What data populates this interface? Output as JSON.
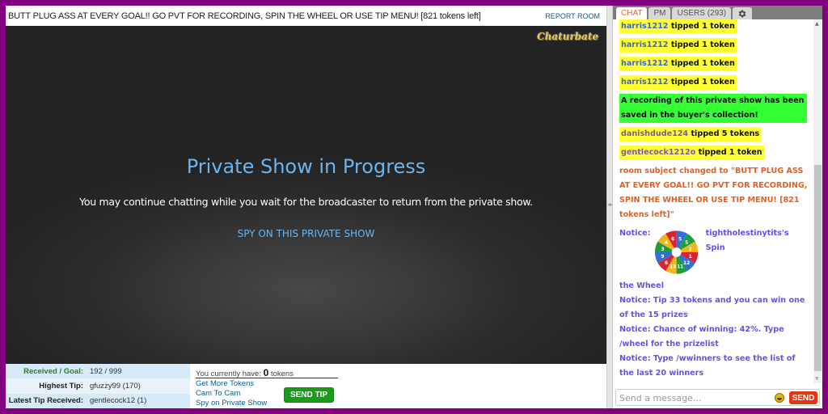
{
  "header": {
    "room_subject": "BUTT PLUG ASS AT EVERY GOAL!! GO PVT FOR RECORDING, SPIN THE WHEEL OR USE TIP MENU! [821 tokens left]",
    "report_room": "REPORT ROOM"
  },
  "video": {
    "logo_text": "Chaturbate",
    "title": "Private Show in Progress",
    "subtitle": "You may continue chatting while you wait for the broadcaster to return from the private show.",
    "spy_link": "SPY ON THIS PRIVATE SHOW"
  },
  "stats": [
    {
      "label": "Received / Goal:",
      "value": "192 / 999"
    },
    {
      "label": "Highest Tip:",
      "value": "gfuzzy99 (170)"
    },
    {
      "label": "Latest Tip Received:",
      "value": "gentlecock12 (1)"
    }
  ],
  "tip": {
    "have_prefix": "You currently have:",
    "have_amount": "0",
    "have_suffix": "tokens",
    "links": [
      "Get More Tokens",
      "Cam To Cam",
      "Spy on Private Show"
    ],
    "send_tip": "SEND TIP"
  },
  "chat": {
    "tabs": [
      {
        "label": "CHAT",
        "active": true
      },
      {
        "label": "PM",
        "active": false
      },
      {
        "label": "USERS (293)",
        "active": false
      }
    ],
    "settings_icon": "gear-icon",
    "messages": {
      "tip1": {
        "user": "harris1212",
        "text": "tipped 1 token"
      },
      "tip2": {
        "user": "harris1212",
        "text": "tipped 1 token"
      },
      "tip3": {
        "user": "harris1212",
        "text": "tipped 1 token"
      },
      "tip4": {
        "user": "harris1212",
        "text": "tipped 1 token"
      },
      "recording": "A recording of this private show has been saved in the buyer's collection!",
      "tip5": {
        "user": "danishdude124",
        "text": "tipped 5 tokens"
      },
      "tip6": {
        "user": "gentlecock1212o",
        "text": "tipped 1 token"
      },
      "room_subject_changed": "room subject changed to \"BUTT PLUG ASS AT EVERY GOAL!! GO PVT FOR RECORDING, SPIN THE WHEEL OR USE TIP MENU! [821 tokens left]\"",
      "notice_wheel_prefix": "Notice:",
      "notice_wheel_text": "tightholestinytits's Spin",
      "notice_wheel_cont": "the Wheel",
      "notice2": "Notice: Tip 33 tokens and you can win one of the 15 prizes",
      "notice3": "Notice: Chance of winning: 42%. Type /wheel for the prizelist",
      "notice4": "Notice: Type /wwinners to see the list of the last 20 winners"
    },
    "wheel_numbers": [
      "5",
      "5",
      "2",
      "1",
      "12",
      "11",
      "13",
      "6",
      "9",
      "3",
      "4",
      "6"
    ],
    "input_placeholder": "Send a message...",
    "send_label": "SEND"
  },
  "colors": {
    "frame": "#800080",
    "tip_highlight": "#ffff33",
    "recording_highlight": "#33ff33",
    "room_subject": "#e65f1f",
    "notice": "#6b4df0",
    "send_tip": "#1a9c1a",
    "send": "#e5350e"
  }
}
